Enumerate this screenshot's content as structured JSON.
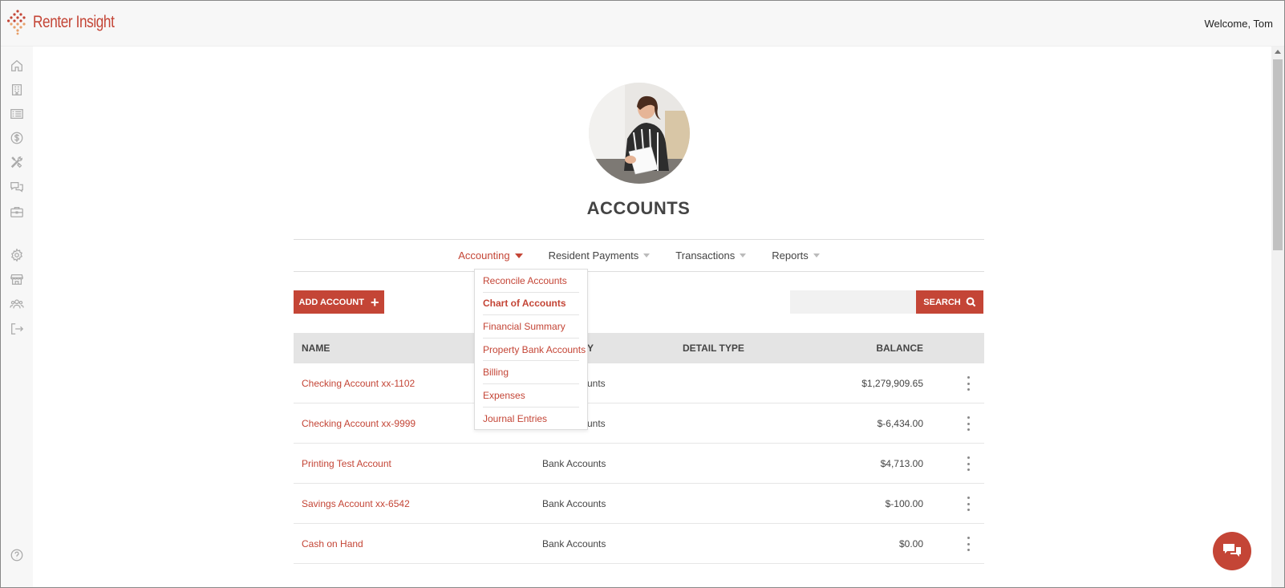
{
  "app": {
    "brand": "Renter Insight",
    "welcome": "Welcome, Tom",
    "accent_color": "#c44536"
  },
  "sidebar": {
    "items": [
      {
        "icon": "home-icon"
      },
      {
        "icon": "building-icon"
      },
      {
        "icon": "list-icon"
      },
      {
        "icon": "dollar-icon"
      },
      {
        "icon": "tools-icon"
      },
      {
        "icon": "chat-icon"
      },
      {
        "icon": "briefcase-icon"
      },
      {
        "icon": "gear-icon"
      },
      {
        "icon": "store-icon"
      },
      {
        "icon": "users-icon"
      },
      {
        "icon": "logout-icon"
      },
      {
        "icon": "help-icon"
      }
    ]
  },
  "page": {
    "title": "ACCOUNTS"
  },
  "nav": {
    "items": [
      {
        "label": "Accounting"
      },
      {
        "label": "Resident Payments"
      },
      {
        "label": "Transactions"
      },
      {
        "label": "Reports"
      }
    ],
    "active": "Accounting"
  },
  "dropdown": {
    "items": [
      {
        "label": "Reconcile Accounts"
      },
      {
        "label": "Chart of Accounts"
      },
      {
        "label": "Financial Summary"
      },
      {
        "label": "Property Bank Accounts"
      },
      {
        "label": "Billing"
      },
      {
        "label": "Expenses"
      },
      {
        "label": "Journal Entries"
      }
    ],
    "active": "Chart of Accounts"
  },
  "toolbar": {
    "add_label": "ADD ACCOUNT",
    "search_placeholder": "",
    "search_label": "SEARCH"
  },
  "table": {
    "headers": {
      "name": "NAME",
      "type": "Y",
      "detail": "DETAIL TYPE",
      "balance": "BALANCE"
    },
    "rows": [
      {
        "name": "Checking Account xx-1102",
        "type": "unts",
        "detail": "",
        "balance": "$1,279,909.65"
      },
      {
        "name": "Checking Account xx-9999",
        "type": "unts",
        "detail": "",
        "balance": "$-6,434.00"
      },
      {
        "name": "Printing Test Account",
        "type": "Bank Accounts",
        "detail": "",
        "balance": "$4,713.00"
      },
      {
        "name": "Savings Account xx-6542",
        "type": "Bank Accounts",
        "detail": "",
        "balance": "$-100.00"
      },
      {
        "name": "Cash on Hand",
        "type": "Bank Accounts",
        "detail": "",
        "balance": "$0.00"
      }
    ]
  }
}
